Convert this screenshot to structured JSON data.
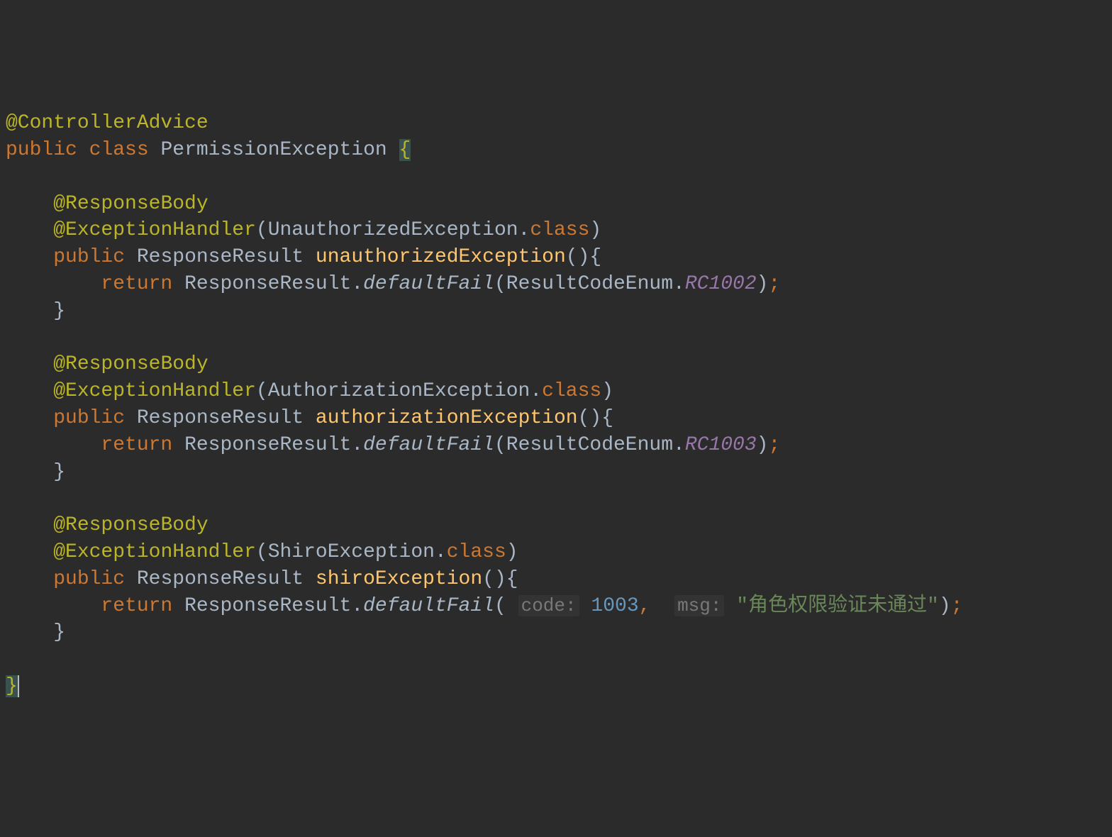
{
  "code": {
    "line1": {
      "annotation": "@ControllerAdvice"
    },
    "line2": {
      "kw_public": "public",
      "kw_class": "class",
      "class_name": "PermissionException",
      "brace": "{"
    },
    "method1": {
      "ann_responsebody": "@ResponseBody",
      "ann_exhandler": "@ExceptionHandler",
      "exception_type": "UnauthorizedException",
      "kw_class": "class",
      "kw_public": "public",
      "return_type": "ResponseResult",
      "method_name": "unauthorizedException",
      "kw_return": "return",
      "call_class": "ResponseResult",
      "call_method": "defaultFail",
      "arg_class": "ResultCodeEnum",
      "arg_enum": "RC1002"
    },
    "method2": {
      "ann_responsebody": "@ResponseBody",
      "ann_exhandler": "@ExceptionHandler",
      "exception_type": "AuthorizationException",
      "kw_class": "class",
      "kw_public": "public",
      "return_type": "ResponseResult",
      "method_name": "authorizationException",
      "kw_return": "return",
      "call_class": "ResponseResult",
      "call_method": "defaultFail",
      "arg_class": "ResultCodeEnum",
      "arg_enum": "RC1003"
    },
    "method3": {
      "ann_responsebody": "@ResponseBody",
      "ann_exhandler": "@ExceptionHandler",
      "exception_type": "ShiroException",
      "kw_class": "class",
      "kw_public": "public",
      "return_type": "ResponseResult",
      "method_name": "shiroException",
      "kw_return": "return",
      "call_class": "ResponseResult",
      "call_method": "defaultFail",
      "hint_code": "code:",
      "arg_code": "1003",
      "comma": ",",
      "hint_msg": "msg:",
      "arg_msg": "\"角色权限验证未通过\""
    },
    "closing_brace": "}"
  }
}
